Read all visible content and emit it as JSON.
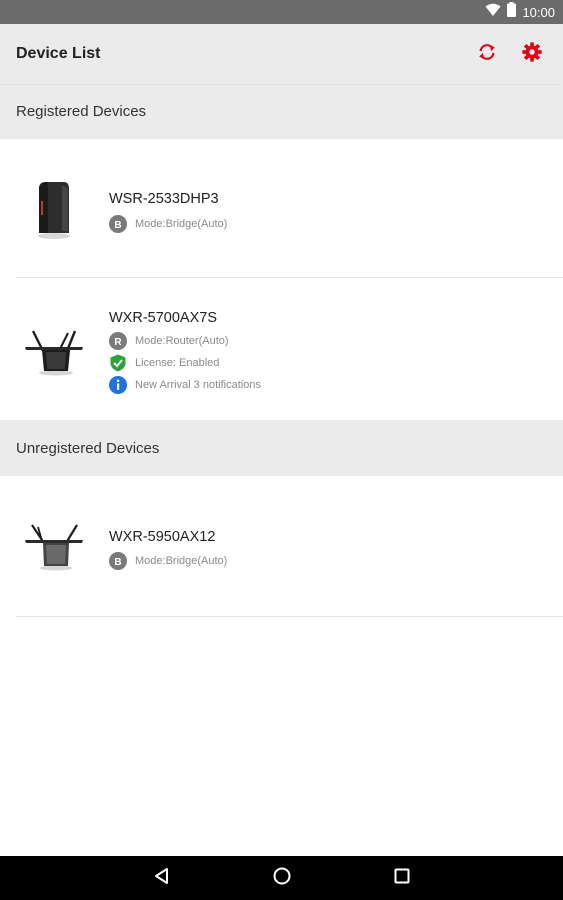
{
  "status_bar": {
    "time": "10:00",
    "icons": [
      "wifi-icon",
      "battery-icon"
    ]
  },
  "app_bar": {
    "title": "Device List",
    "actions": [
      "refresh-icon",
      "settings-icon"
    ],
    "accent_color": "#e60012"
  },
  "sections": {
    "registered": {
      "label": "Registered Devices",
      "devices": [
        {
          "name": "WSR-2533DHP3",
          "image": "router-vertical-image",
          "info": [
            {
              "icon": "mode-bridge-icon",
              "letter": "B",
              "text": "Mode:Bridge(Auto)"
            }
          ]
        },
        {
          "name": "WXR-5700AX7S",
          "image": "router-antenna-image",
          "info": [
            {
              "icon": "mode-router-icon",
              "letter": "R",
              "text": "Mode:Router(Auto)"
            },
            {
              "icon": "license-check-icon",
              "text": "License: Enabled",
              "color": "#2aa43a"
            },
            {
              "icon": "info-icon",
              "text": "New Arrival 3 notifications",
              "color": "#1a73e8"
            }
          ]
        }
      ]
    },
    "unregistered": {
      "label": "Unregistered Devices",
      "devices": [
        {
          "name": "WXR-5950AX12",
          "image": "router-antenna-image",
          "info": [
            {
              "icon": "mode-bridge-icon",
              "letter": "B",
              "text": "Mode:Bridge(Auto)"
            }
          ]
        }
      ]
    }
  },
  "nav_bar": {
    "buttons": [
      "back-icon",
      "home-icon",
      "recents-icon"
    ]
  }
}
